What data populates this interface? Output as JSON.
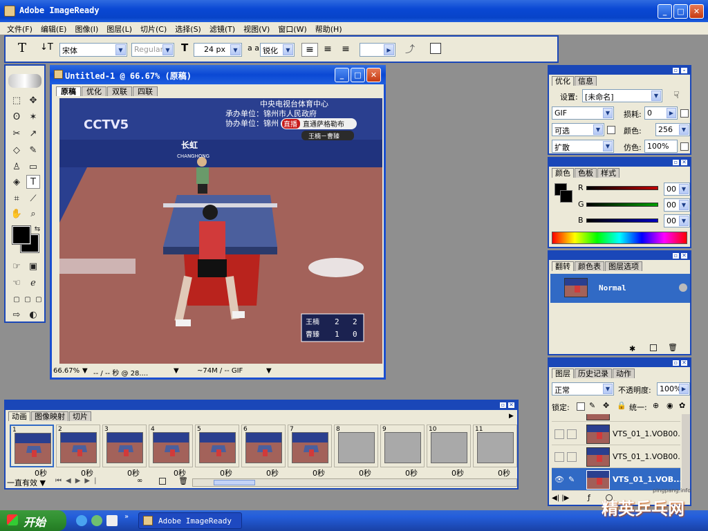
{
  "app": {
    "title": "Adobe ImageReady"
  },
  "menu": [
    "文件(F)",
    "编辑(E)",
    "图像(I)",
    "图层(L)",
    "切片(C)",
    "选择(S)",
    "滤镜(T)",
    "视图(V)",
    "窗口(W)",
    "帮助(H)"
  ],
  "options": {
    "font_family": "宋体",
    "font_style": "Regular",
    "font_size": "24 px",
    "antialias_icon_label": "a a",
    "antialias": "锐化"
  },
  "document": {
    "title": "Untitled-1 @ 66.67% (原稿)",
    "tabs": [
      "原稿",
      "优化",
      "双联",
      "四联"
    ],
    "active_tab": "原稿",
    "zoom": "66.67%",
    "status_time": "-- / -- 秒 @ 28....",
    "status_size": "~74M / -- GIF",
    "overlay": {
      "broadcaster": "中央电视台体育中心",
      "host_label": "承办单位：锦州市人民政府",
      "coorg_label": "协办单位：锦州",
      "live_badge": "直播",
      "live_text": "直通萨格勒布",
      "match_text": "王楠－曹臻",
      "channel": "CCTV5",
      "sponsor": "长虹",
      "sponsor_en": "CHANGHONG",
      "score": [
        {
          "name": "王楠",
          "g1": "2",
          "g2": "2"
        },
        {
          "name": "曹臻",
          "g1": "1",
          "g2": "0"
        }
      ]
    }
  },
  "optimize_panel": {
    "tabs": [
      "优化",
      "信息"
    ],
    "settings_label": "设置:",
    "settings_value": "[未命名]",
    "format": "GIF",
    "lossy_label": "损耗:",
    "lossy": "0",
    "palette": "可选",
    "colors_label": "颜色:",
    "colors": "256",
    "dither": "扩散",
    "dither_label": "仿色:",
    "dither_amount": "100%"
  },
  "color_panel": {
    "tabs": [
      "颜色",
      "色板",
      "样式"
    ],
    "channels": [
      {
        "label": "R",
        "value": "00",
        "color": "#c00000"
      },
      {
        "label": "G",
        "value": "00",
        "color": "#008000"
      },
      {
        "label": "B",
        "value": "00",
        "color": "#0000c0"
      }
    ]
  },
  "rollover_panel": {
    "tabs": [
      "翻转",
      "颜色表",
      "图层选项"
    ],
    "state": "Normal"
  },
  "layers_panel": {
    "tabs": [
      "图层",
      "历史记录",
      "动作"
    ],
    "blend_mode": "正常",
    "opacity_label": "不透明度:",
    "opacity": "100%",
    "lock_label": "锁定:",
    "unify_label": "统一:",
    "layers": [
      {
        "name": "VTS_01_1.VOB00...",
        "visible": false,
        "selected": false
      },
      {
        "name": "VTS_01_1.VOB00...",
        "visible": false,
        "selected": false
      },
      {
        "name": "VTS_01_1.VOB...",
        "visible": true,
        "selected": true
      }
    ]
  },
  "animation_panel": {
    "tabs": [
      "动画",
      "图像映射",
      "切片"
    ],
    "loop": "一直有效",
    "frames": [
      {
        "num": "1",
        "time": "0秒",
        "filled": true
      },
      {
        "num": "2",
        "time": "0秒",
        "filled": true
      },
      {
        "num": "3",
        "time": "0秒",
        "filled": true
      },
      {
        "num": "4",
        "time": "0秒",
        "filled": true
      },
      {
        "num": "5",
        "time": "0秒",
        "filled": true
      },
      {
        "num": "6",
        "time": "0秒",
        "filled": true
      },
      {
        "num": "7",
        "time": "0秒",
        "filled": true
      },
      {
        "num": "8",
        "time": "0秒",
        "filled": false
      },
      {
        "num": "9",
        "time": "0秒",
        "filled": false
      },
      {
        "num": "10",
        "time": "0秒",
        "filled": false
      },
      {
        "num": "11",
        "time": "0秒",
        "filled": false
      }
    ]
  },
  "taskbar": {
    "start": "开始",
    "task": "Adobe ImageReady"
  },
  "watermark": {
    "site": "pingpang.info",
    "text": "精英乒乓网"
  }
}
